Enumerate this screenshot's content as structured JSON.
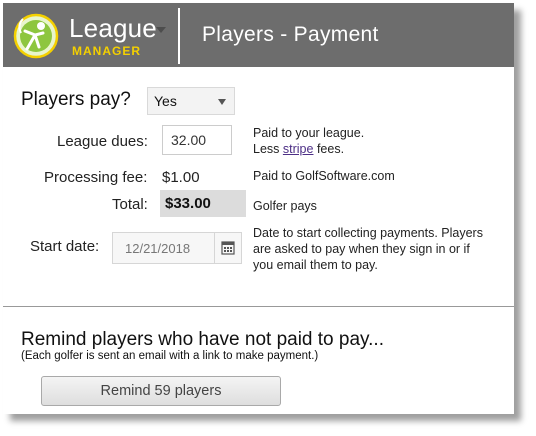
{
  "header": {
    "logo_line1": "League",
    "logo_line2": "MANAGER",
    "title": "Players - Payment",
    "colors": {
      "bar": "#6d6d6d",
      "logo_green": "#8dc63f",
      "logo_yellow": "#f4d000"
    }
  },
  "form": {
    "players_pay_label": "Players pay?",
    "players_pay_value": "Yes",
    "league_dues_label": "League dues:",
    "league_dues_value": "32.00",
    "league_dues_note_line1": "Paid to your league.",
    "league_dues_note_prefix": "Less ",
    "league_dues_note_link": "stripe",
    "league_dues_note_suffix": " fees.",
    "processing_fee_label": "Processing fee:",
    "processing_fee_value": "$1.00",
    "processing_fee_note": "Paid to GolfSoftware.com",
    "total_label": "Total:",
    "total_value": "$33.00",
    "total_note": "Golfer pays",
    "start_date_label": "Start date:",
    "start_date_value": "12/21/2018",
    "start_date_note_line1": "Date to start collecting payments. Players",
    "start_date_note_line2": "are asked to pay when they sign in or if",
    "start_date_note_line3": "you email them to pay.",
    "calendar_icon": "calendar-icon"
  },
  "remind": {
    "title": "Remind players who have not paid to pay...",
    "subtitle": "(Each golfer is sent an email with a link to make payment.)",
    "button_label": "Remind 59 players"
  }
}
